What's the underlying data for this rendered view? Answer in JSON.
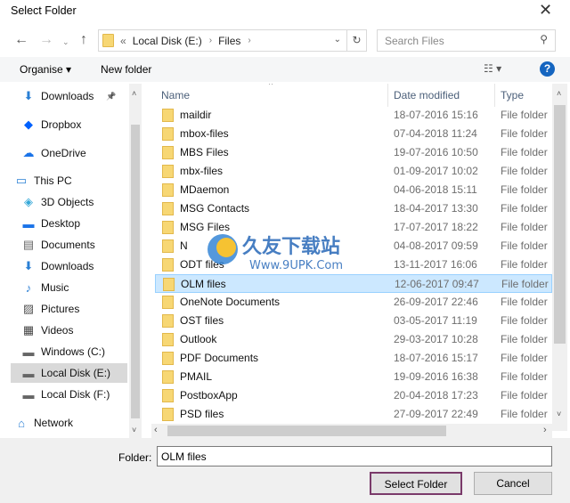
{
  "window": {
    "title": "Select Folder"
  },
  "address": {
    "crumbs": [
      "«",
      "Local Disk (E:)",
      "Files"
    ],
    "search_placeholder": "Search Files"
  },
  "toolbar": {
    "organise": "Organise ▾",
    "new_folder": "New folder",
    "views": "☷ ▾",
    "help": "?"
  },
  "sidebar": {
    "items": [
      {
        "label": "Downloads",
        "icon": "download-icon"
      },
      {
        "label": "Dropbox",
        "icon": "dropbox-icon"
      },
      {
        "label": "OneDrive",
        "icon": "cloud-icon"
      },
      {
        "label": "This PC",
        "icon": "computer-icon"
      },
      {
        "label": "3D Objects",
        "icon": "cube-icon"
      },
      {
        "label": "Desktop",
        "icon": "desktop-icon"
      },
      {
        "label": "Documents",
        "icon": "document-icon"
      },
      {
        "label": "Downloads",
        "icon": "download-icon"
      },
      {
        "label": "Music",
        "icon": "music-icon"
      },
      {
        "label": "Pictures",
        "icon": "pictures-icon"
      },
      {
        "label": "Videos",
        "icon": "video-icon"
      },
      {
        "label": "Windows (C:)",
        "icon": "drive-icon"
      },
      {
        "label": "Local Disk (E:)",
        "icon": "drive-icon",
        "selected": true
      },
      {
        "label": "Local Disk (F:)",
        "icon": "drive-icon"
      },
      {
        "label": "Network",
        "icon": "network-icon"
      }
    ]
  },
  "list": {
    "columns": [
      "Name",
      "Date modified",
      "Type"
    ],
    "rows": [
      {
        "name": "maildir",
        "date": "18-07-2016 15:16",
        "type": "File folder"
      },
      {
        "name": "mbox-files",
        "date": "07-04-2018 11:24",
        "type": "File folder"
      },
      {
        "name": "MBS Files",
        "date": "19-07-2016 10:50",
        "type": "File folder"
      },
      {
        "name": "mbx-files",
        "date": "01-09-2017 10:02",
        "type": "File folder"
      },
      {
        "name": "MDaemon",
        "date": "04-06-2018 15:11",
        "type": "File folder"
      },
      {
        "name": "MSG Contacts",
        "date": "18-04-2017 13:30",
        "type": "File folder"
      },
      {
        "name": "MSG Files",
        "date": "17-07-2017 18:22",
        "type": "File folder"
      },
      {
        "name": "N",
        "date": "04-08-2017 09:59",
        "type": "File folder"
      },
      {
        "name": "ODT files",
        "date": "13-11-2017 16:06",
        "type": "File folder"
      },
      {
        "name": "OLM files",
        "date": "12-06-2017 09:47",
        "type": "File folder",
        "selected": true
      },
      {
        "name": "OneNote Documents",
        "date": "26-09-2017 22:46",
        "type": "File folder"
      },
      {
        "name": "OST files",
        "date": "03-05-2017 11:19",
        "type": "File folder"
      },
      {
        "name": "Outlook",
        "date": "29-03-2017 10:28",
        "type": "File folder"
      },
      {
        "name": "PDF Documents",
        "date": "18-07-2016 15:17",
        "type": "File folder"
      },
      {
        "name": "PMAIL",
        "date": "19-09-2016 16:38",
        "type": "File folder"
      },
      {
        "name": "PostboxApp",
        "date": "20-04-2018 17:23",
        "type": "File folder"
      },
      {
        "name": "PSD files",
        "date": "27-09-2017 22:49",
        "type": "File folder"
      }
    ]
  },
  "footer": {
    "folder_label": "Folder:",
    "folder_value": "OLM files",
    "select_button": "Select Folder",
    "cancel_button": "Cancel"
  },
  "watermark": {
    "text": "久友下载站",
    "url": "Www.9UPK.Com"
  }
}
